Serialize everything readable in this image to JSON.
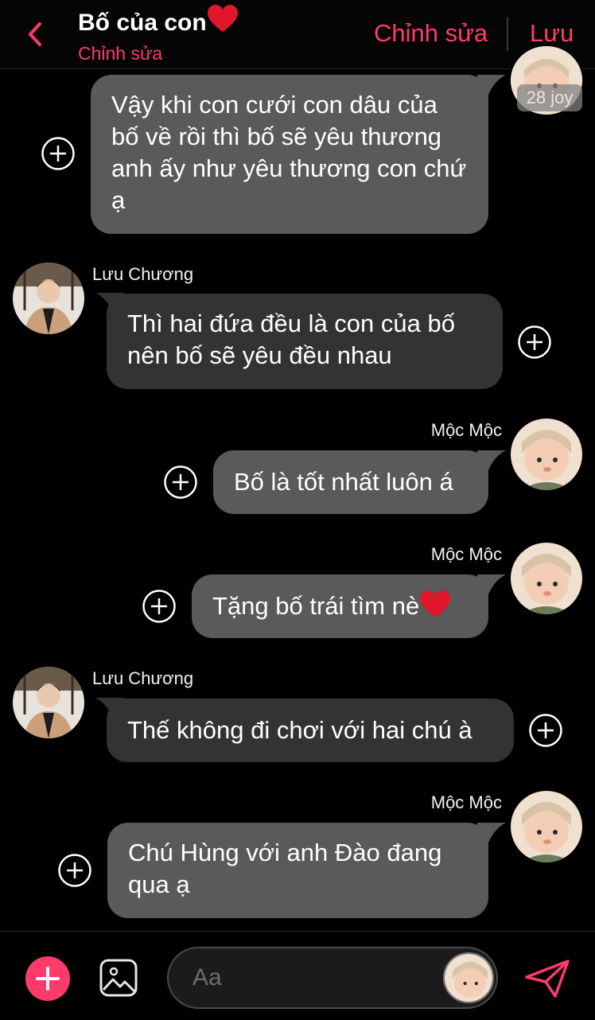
{
  "header": {
    "title": "Bố của con",
    "subtitle": "Chỉnh sửa",
    "edit_label": "Chỉnh sửa",
    "save_label": "Lưu"
  },
  "timestamp": "28 joy",
  "messages": [
    {
      "side": "right",
      "sender": "",
      "text": "Vậy khi con cưới con dâu của bố về rồi thì bố sẽ yêu thương anh ấy như yêu thương con chứ ạ"
    },
    {
      "side": "left",
      "sender": "Lưu Chương",
      "text": "Thì hai đứa đều là con của bố nên bố sẽ yêu đều nhau"
    },
    {
      "side": "right",
      "sender": "Mộc Mộc",
      "text": "Bố là tốt nhất luôn á"
    },
    {
      "side": "right",
      "sender": "Mộc Mộc",
      "text": "Tặng bố trái tìm nè"
    },
    {
      "side": "left",
      "sender": "Lưu Chương",
      "text": "Thế không đi chơi với hai chú à"
    },
    {
      "side": "right",
      "sender": "Mộc Mộc",
      "text": "Chú Hùng với anh Đào đang qua ạ"
    }
  ],
  "composer": {
    "placeholder": "Aa"
  },
  "colors": {
    "accent": "#ff3b6b",
    "bubble_right": "#5a5a5a",
    "bubble_left": "#333333",
    "heart": "#e0162b"
  },
  "icons": [
    "back-chevron-icon",
    "heart-icon",
    "plus-circle-icon",
    "add-icon",
    "image-icon",
    "send-icon"
  ]
}
